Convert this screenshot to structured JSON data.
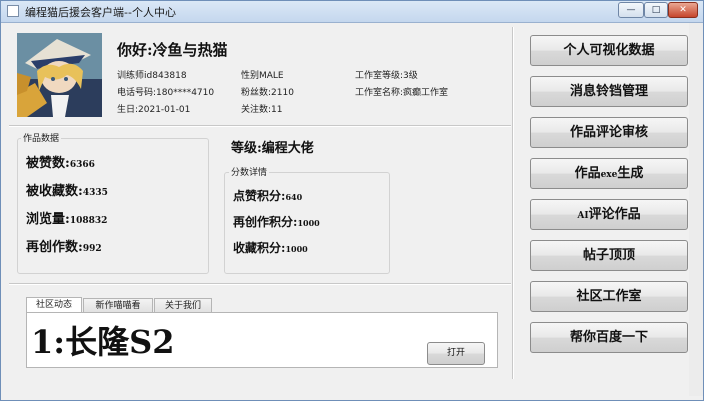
{
  "window": {
    "title": "编程猫后援会客户端--个人中心",
    "controls": {
      "minimize": "—",
      "maximize": "□",
      "close": "✕"
    }
  },
  "profile": {
    "greeting": "你好:冷鱼与热猫",
    "trainer_id": "训练师id843818",
    "gender": "性别MALE",
    "studio_level": "工作室等级:3级",
    "phone": "电话号码:180****4710",
    "fans": "粉丝数:2110",
    "studio_name": "工作室名称:疯癫工作室",
    "birthday": "生日:2021-01-01",
    "following": "关注数:11"
  },
  "works": {
    "group_title": "作品数据",
    "likes_label": "被赞数:",
    "likes_value": "6366",
    "favorites_label": "被收藏数:",
    "favorites_value": "4335",
    "views_label": "浏览量:",
    "views_value": "108832",
    "recreations_label": "再创作数:",
    "recreations_value": "992"
  },
  "level": {
    "text": "等级:编程大佬"
  },
  "scores": {
    "group_title": "分数详情",
    "like_score_label": "点赞积分:",
    "like_score_value": "640",
    "recreate_score_label": "再创作积分:",
    "recreate_score_value": "1000",
    "favorite_score_label": "收藏积分:",
    "favorite_score_value": "1000"
  },
  "side_menu": {
    "visual_data": "个人可视化数据",
    "notification_mgmt": "消息铃铛管理",
    "comment_review": "作品评论审核",
    "exe_prefix": "作品",
    "exe_small": "exe",
    "exe_suffix": "生成",
    "ai_small": "AI",
    "ai_suffix": "评论作品",
    "pin_post": "帖子顶顶",
    "community_studio": "社区工作室",
    "baidu": "帮你百度一下"
  },
  "tabs": {
    "items": [
      "社区动态",
      "新作喵喵看",
      "关于我们"
    ],
    "active": 0,
    "content_text": "1:长隆S2",
    "open_button": "打开"
  },
  "colors": {
    "title_bar": "#c4d7ee",
    "close_button": "#c6452c",
    "background": "#f0f0f0"
  }
}
